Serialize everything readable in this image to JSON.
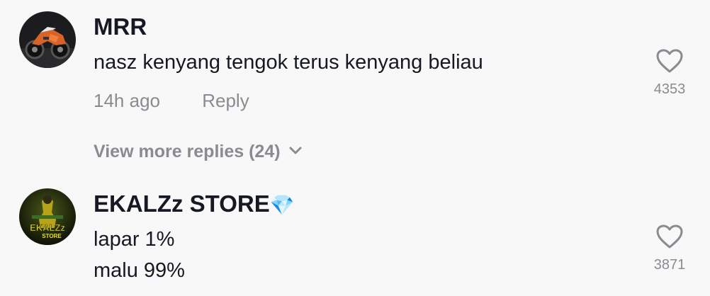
{
  "comments": [
    {
      "username": "MRR",
      "text_lines": [
        "nasz kenyang tengok terus kenyang beliau"
      ],
      "time": "14h ago",
      "reply_label": "Reply",
      "likes": "4353",
      "view_more": "View more replies (24)",
      "avatar_icon": "motorcycle-avatar"
    },
    {
      "username": "EKALZz STORE",
      "username_emoji": "💎",
      "text_lines": [
        "lapar 1%",
        "malu 99%"
      ],
      "likes": "3871",
      "avatar_icon": "ekalzz-store-logo-avatar",
      "avatar_logo_text": [
        "EKALZz",
        "STORE"
      ]
    }
  ],
  "colors": {
    "background": "#f8f8f8",
    "primary_text": "#161823",
    "secondary_text": "#8a8b91",
    "heart_outline": "#8a8b91"
  }
}
